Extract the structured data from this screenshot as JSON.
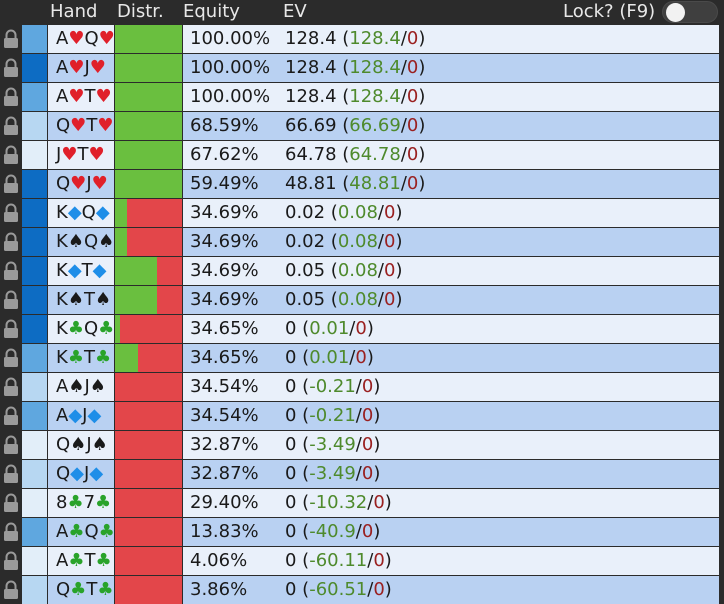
{
  "header": {
    "hand": "Hand",
    "distr": "Distr.",
    "equity": "Equity",
    "ev": "EV",
    "lock": "Lock? (F9)"
  },
  "colors": {
    "heart": "#e0202a",
    "diamond": "#1e8ee8",
    "club": "#29a32a",
    "spade": "#1a1a1a",
    "distr_green": "#6abf3f",
    "distr_red": "#e3464a",
    "row_light": "#e9f0fa",
    "row_dark": "#b9d1f2"
  },
  "rows": [
    {
      "hand": [
        [
          "A",
          "heart"
        ],
        [
          "Q",
          "heart"
        ]
      ],
      "equity": "100.00%",
      "ev": "128.4",
      "ev_a": "128.4",
      "ev_b": "0",
      "strip": "#5fa7df",
      "distr": 1.0,
      "bg": "light"
    },
    {
      "hand": [
        [
          "A",
          "heart"
        ],
        [
          "J",
          "heart"
        ]
      ],
      "equity": "100.00%",
      "ev": "128.4",
      "ev_a": "128.4",
      "ev_b": "0",
      "strip": "#0d6cc3",
      "distr": 1.0,
      "bg": "dark"
    },
    {
      "hand": [
        [
          "A",
          "heart"
        ],
        [
          "T",
          "heart"
        ]
      ],
      "equity": "100.00%",
      "ev": "128.4",
      "ev_a": "128.4",
      "ev_b": "0",
      "strip": "#5fa7df",
      "distr": 1.0,
      "bg": "light"
    },
    {
      "hand": [
        [
          "Q",
          "heart"
        ],
        [
          "T",
          "heart"
        ]
      ],
      "equity": "68.59%",
      "ev": "66.69",
      "ev_a": "66.69",
      "ev_b": "0",
      "strip": "#b7d7f2",
      "distr": 1.0,
      "bg": "dark"
    },
    {
      "hand": [
        [
          "J",
          "heart"
        ],
        [
          "T",
          "heart"
        ]
      ],
      "equity": "67.62%",
      "ev": "64.78",
      "ev_a": "64.78",
      "ev_b": "0",
      "strip": "#e2eef9",
      "distr": 1.0,
      "bg": "light"
    },
    {
      "hand": [
        [
          "Q",
          "heart"
        ],
        [
          "J",
          "heart"
        ]
      ],
      "equity": "59.49%",
      "ev": "48.81",
      "ev_a": "48.81",
      "ev_b": "0",
      "strip": "#0d6cc3",
      "distr": 1.0,
      "bg": "dark"
    },
    {
      "hand": [
        [
          "K",
          "diamond"
        ],
        [
          "Q",
          "diamond"
        ]
      ],
      "equity": "34.69%",
      "ev": "0.02",
      "ev_a": "0.08",
      "ev_b": "0",
      "strip": "#0d6cc3",
      "distr": 0.18,
      "bg": "light"
    },
    {
      "hand": [
        [
          "K",
          "spade"
        ],
        [
          "Q",
          "spade"
        ]
      ],
      "equity": "34.69%",
      "ev": "0.02",
      "ev_a": "0.08",
      "ev_b": "0",
      "strip": "#0d6cc3",
      "distr": 0.18,
      "bg": "dark"
    },
    {
      "hand": [
        [
          "K",
          "diamond"
        ],
        [
          "T",
          "diamond"
        ]
      ],
      "equity": "34.69%",
      "ev": "0.05",
      "ev_a": "0.08",
      "ev_b": "0",
      "strip": "#0d6cc3",
      "distr": 0.63,
      "bg": "light"
    },
    {
      "hand": [
        [
          "K",
          "spade"
        ],
        [
          "T",
          "spade"
        ]
      ],
      "equity": "34.69%",
      "ev": "0.05",
      "ev_a": "0.08",
      "ev_b": "0",
      "strip": "#0d6cc3",
      "distr": 0.63,
      "bg": "dark"
    },
    {
      "hand": [
        [
          "K",
          "club"
        ],
        [
          "Q",
          "club"
        ]
      ],
      "equity": "34.65%",
      "ev": "0",
      "ev_a": "0.01",
      "ev_b": "0",
      "strip": "#0d6cc3",
      "distr": 0.08,
      "bg": "light"
    },
    {
      "hand": [
        [
          "K",
          "club"
        ],
        [
          "T",
          "club"
        ]
      ],
      "equity": "34.65%",
      "ev": "0",
      "ev_a": "0.01",
      "ev_b": "0",
      "strip": "#5fa7df",
      "distr": 0.35,
      "bg": "dark"
    },
    {
      "hand": [
        [
          "A",
          "spade"
        ],
        [
          "J",
          "spade"
        ]
      ],
      "equity": "34.54%",
      "ev": "0",
      "ev_a": "-0.21",
      "ev_b": "0",
      "strip": "#b7d7f2",
      "distr": 0.0,
      "bg": "light"
    },
    {
      "hand": [
        [
          "A",
          "diamond"
        ],
        [
          "J",
          "diamond"
        ]
      ],
      "equity": "34.54%",
      "ev": "0",
      "ev_a": "-0.21",
      "ev_b": "0",
      "strip": "#5fa7df",
      "distr": 0.0,
      "bg": "dark"
    },
    {
      "hand": [
        [
          "Q",
          "spade"
        ],
        [
          "J",
          "spade"
        ]
      ],
      "equity": "32.87%",
      "ev": "0",
      "ev_a": "-3.49",
      "ev_b": "0",
      "strip": "#e2eef9",
      "distr": 0.0,
      "bg": "light"
    },
    {
      "hand": [
        [
          "Q",
          "diamond"
        ],
        [
          "J",
          "diamond"
        ]
      ],
      "equity": "32.87%",
      "ev": "0",
      "ev_a": "-3.49",
      "ev_b": "0",
      "strip": "#b7d7f2",
      "distr": 0.0,
      "bg": "dark"
    },
    {
      "hand": [
        [
          "8",
          "club"
        ],
        [
          "7",
          "club"
        ]
      ],
      "equity": "29.40%",
      "ev": "0",
      "ev_a": "-10.32",
      "ev_b": "0",
      "strip": "#e2eef9",
      "distr": 0.0,
      "bg": "light"
    },
    {
      "hand": [
        [
          "A",
          "club"
        ],
        [
          "Q",
          "club"
        ]
      ],
      "equity": "13.83%",
      "ev": "0",
      "ev_a": "-40.9",
      "ev_b": "0",
      "strip": "#5fa7df",
      "distr": 0.0,
      "bg": "dark"
    },
    {
      "hand": [
        [
          "A",
          "club"
        ],
        [
          "T",
          "club"
        ]
      ],
      "equity": "4.06%",
      "ev": "0",
      "ev_a": "-60.11",
      "ev_b": "0",
      "strip": "#e2eef9",
      "distr": 0.0,
      "bg": "light"
    },
    {
      "hand": [
        [
          "Q",
          "club"
        ],
        [
          "T",
          "club"
        ]
      ],
      "equity": "3.86%",
      "ev": "0",
      "ev_a": "-60.51",
      "ev_b": "0",
      "strip": "#b7d7f2",
      "distr": 0.0,
      "bg": "dark"
    }
  ]
}
